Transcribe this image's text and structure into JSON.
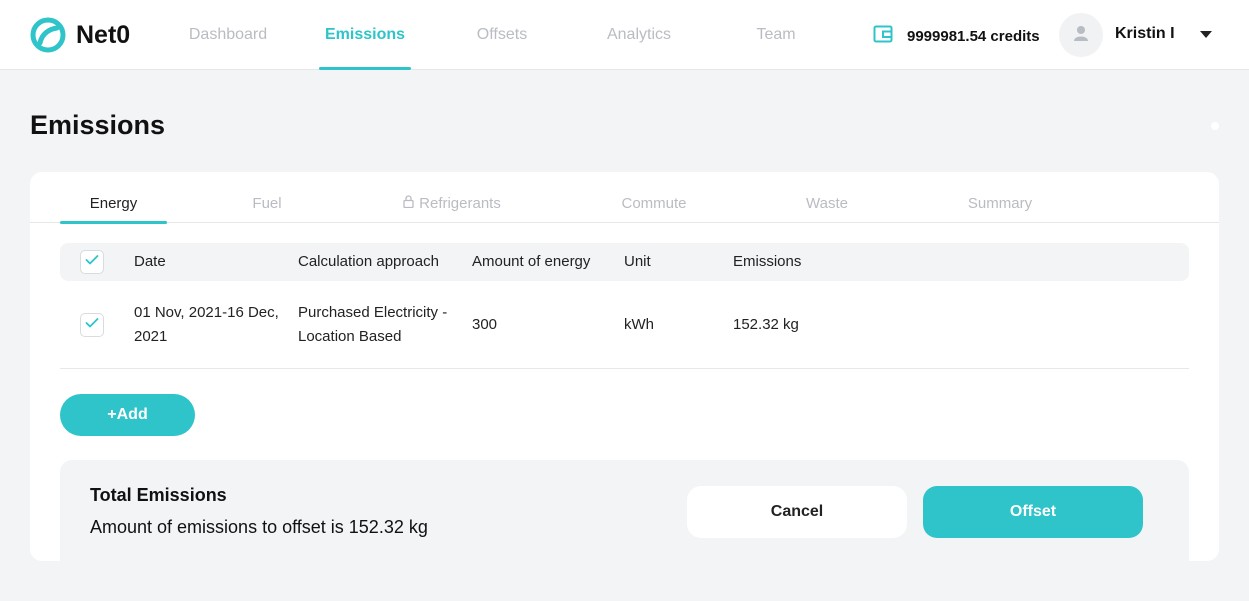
{
  "app": {
    "name": "Net0",
    "brand_color": "#2ec4c9"
  },
  "nav": {
    "items": [
      {
        "label": "Dashboard",
        "active": false
      },
      {
        "label": "Emissions",
        "active": true
      },
      {
        "label": "Offsets",
        "active": false
      },
      {
        "label": "Analytics",
        "active": false
      },
      {
        "label": "Team",
        "active": false
      }
    ]
  },
  "header": {
    "credits": "9999981.54 credits",
    "user_name": "Kristin I",
    "icons": [
      "wallet-icon",
      "user-icon",
      "caret-down-icon"
    ]
  },
  "page": {
    "title": "Emissions"
  },
  "tabs": [
    {
      "label": "Energy",
      "active": true,
      "locked": false
    },
    {
      "label": "Fuel",
      "active": false,
      "locked": false
    },
    {
      "label": "Refrigerants",
      "active": false,
      "locked": true
    },
    {
      "label": "Commute",
      "active": false,
      "locked": false
    },
    {
      "label": "Waste",
      "active": false,
      "locked": false
    },
    {
      "label": "Summary",
      "active": false,
      "locked": false
    }
  ],
  "table": {
    "columns": [
      "Date",
      "Calculation approach",
      "Amount of energy",
      "Unit",
      "Emissions"
    ],
    "header_checked": true,
    "rows": [
      {
        "checked": true,
        "date": "01 Nov, 2021-16 Dec, 2021",
        "approach": "Purchased Electricity - Location Based",
        "amount": "300",
        "unit": "kWh",
        "emissions": "152.32 kg"
      }
    ]
  },
  "actions": {
    "add_label": "+Add",
    "cancel_label": "Cancel",
    "offset_label": "Offset"
  },
  "summary": {
    "title": "Total Emissions",
    "text": "Amount of emissions to offset is 152.32 kg"
  }
}
